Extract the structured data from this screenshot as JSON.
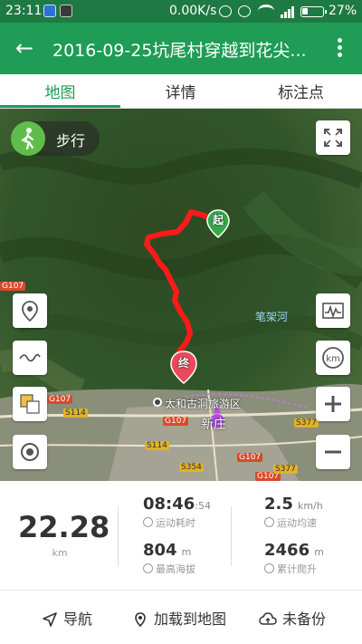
{
  "status_bar": {
    "time": "23:11",
    "net_speed": "0.00K/s",
    "battery": "27%"
  },
  "toolbar": {
    "title": "2016-09-25坑尾村穿越到花尖..."
  },
  "tabs": [
    {
      "label": "地图"
    },
    {
      "label": "详情"
    },
    {
      "label": "标注点"
    }
  ],
  "map": {
    "mode_label": "步行",
    "start_marker": "起",
    "end_marker": "终",
    "places": {
      "river": "笔架河",
      "scenic": "太和古洞旅游区",
      "town": "新庄"
    },
    "roads": [
      "G107",
      "G107",
      "S114",
      "G107",
      "S377",
      "S114",
      "G107",
      "S354",
      "G107",
      "S377"
    ],
    "route_color": "#ff1a1a"
  },
  "stats": {
    "distance": {
      "value": "22.28",
      "unit": "km"
    },
    "duration": {
      "main": "08:46",
      "secs": ":54",
      "label": "运动耗时"
    },
    "avg_speed": {
      "value": "2.5",
      "unit": "km/h",
      "label": "运动均速"
    },
    "max_alt": {
      "value": "804",
      "unit": "m",
      "label": "最高海拔"
    },
    "climb": {
      "value": "2466",
      "unit": "m",
      "label": "累计爬升"
    }
  },
  "bottom": {
    "navigate": "导航",
    "load_map": "加载到地图",
    "backup": "未备份"
  }
}
